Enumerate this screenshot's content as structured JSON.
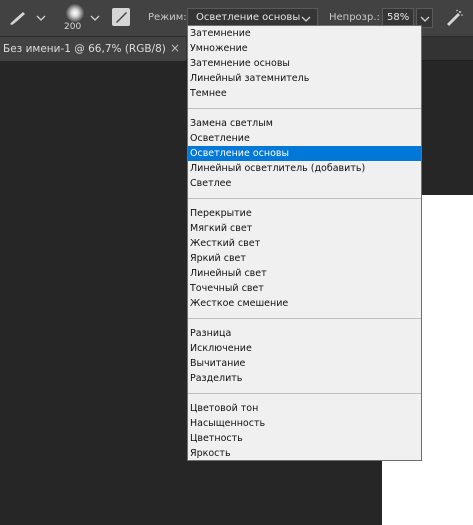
{
  "optbar": {
    "brush_size": "200",
    "mode_label": "Режим:",
    "mode_value": "Осветление основы",
    "opacity_label": "Непрозр.:",
    "opacity_value": "58%"
  },
  "document": {
    "tab_title": "Без имени-1 @ 66,7% (RGB/8)",
    "close_glyph": "×"
  },
  "blend_menu": {
    "groups": [
      [
        "Затемнение",
        "Умножение",
        "Затемнение основы",
        "Линейный затемнитель",
        "Темнее"
      ],
      [
        "Замена светлым",
        "Осветление",
        "Осветление основы",
        "Линейный осветлитель (добавить)",
        "Светлее"
      ],
      [
        "Перекрытие",
        "Мягкий свет",
        "Жесткий свет",
        "Яркий свет",
        "Линейный свет",
        "Точечный свет",
        "Жесткое смешение"
      ],
      [
        "Разница",
        "Исключение",
        "Вычитание",
        "Разделить"
      ],
      [
        "Цветовой тон",
        "Насыщенность",
        "Цветность",
        "Яркость"
      ]
    ],
    "selected": "Осветление основы"
  },
  "colors": {
    "selection": "#0078d7",
    "menu_bg": "#f0f0f0",
    "toolbar_bg": "#424242",
    "canvas_bg": "#262626"
  },
  "icons": {
    "tool": "brush-icon",
    "panel": "brush-panel-icon",
    "airbrush": "airbrush-icon"
  }
}
